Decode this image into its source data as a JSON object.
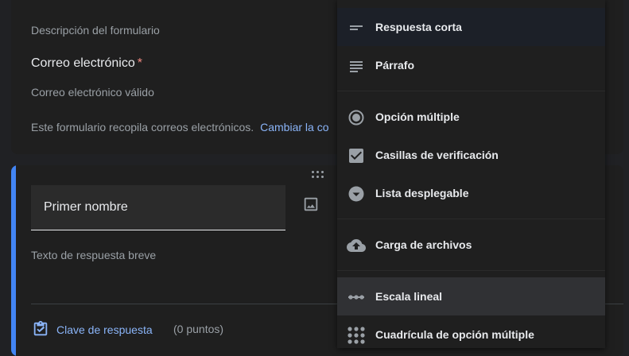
{
  "header": {
    "description": "Descripción del formulario",
    "email_label": "Correo electrónico",
    "required_mark": "*",
    "email_placeholder": "Correo electrónico válido",
    "collecting_text": "Este formulario recopila correos electrónicos.",
    "change_link": "Cambiar la co"
  },
  "question": {
    "title": "Primer nombre",
    "answer_hint": "Texto de respuesta breve",
    "answer_key": "Clave de respuesta",
    "points": "(0 puntos)"
  },
  "menu": {
    "items": [
      {
        "label": "Respuesta corta",
        "icon": "short-answer-icon"
      },
      {
        "label": "Párrafo",
        "icon": "paragraph-icon"
      },
      {
        "label": "Opción múltiple",
        "icon": "radio-button-icon"
      },
      {
        "label": "Casillas de verificación",
        "icon": "checkbox-icon"
      },
      {
        "label": "Lista desplegable",
        "icon": "dropdown-icon"
      },
      {
        "label": "Carga de archivos",
        "icon": "cloud-upload-icon"
      },
      {
        "label": "Escala lineal",
        "icon": "linear-scale-icon"
      },
      {
        "label": "Cuadrícula de opción múltiple",
        "icon": "grid-icon"
      }
    ]
  },
  "colors": {
    "accent": "#4285f4",
    "link": "#8ab4f8",
    "required": "#f28b82"
  }
}
